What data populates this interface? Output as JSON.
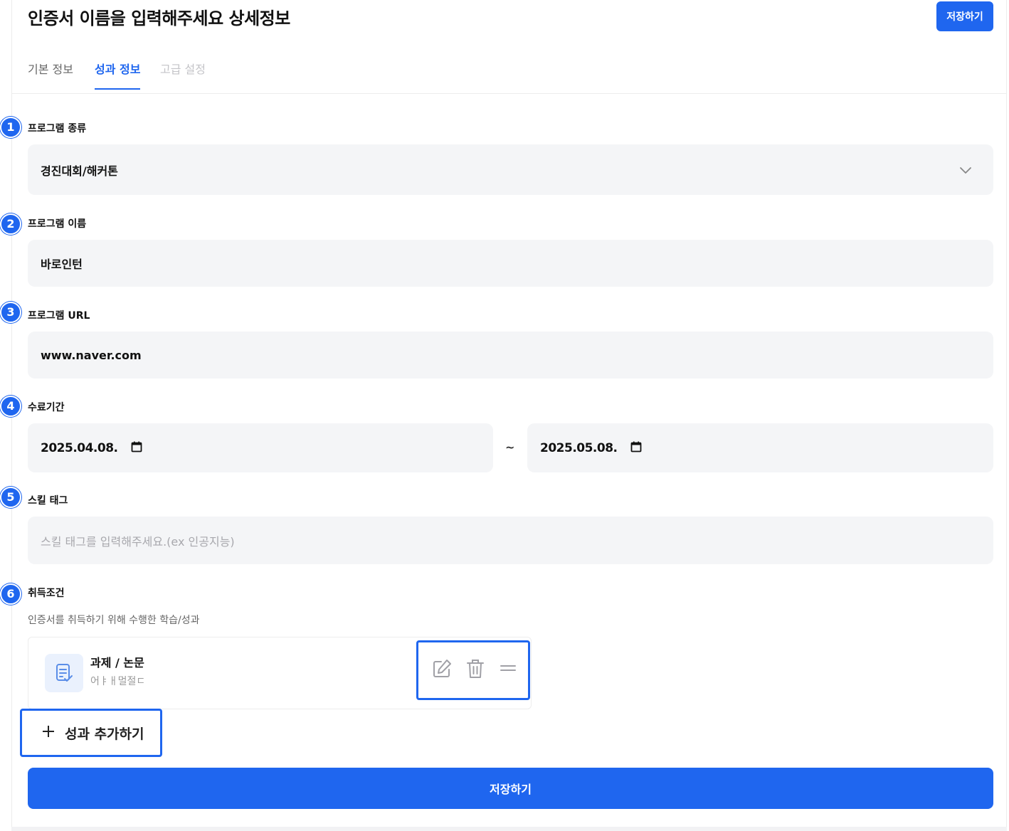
{
  "header": {
    "title": "인증서 이름을 입력해주세요 상세정보",
    "save_label": "저장하기"
  },
  "tabs": [
    {
      "label": "기본 정보",
      "state": "default"
    },
    {
      "label": "성과 정보",
      "state": "active"
    },
    {
      "label": "고급 설정",
      "state": "disabled"
    }
  ],
  "form": {
    "program_type": {
      "marker": "1",
      "label": "프로그램 종류",
      "value": "경진대회/해커톤"
    },
    "program_name": {
      "marker": "2",
      "label": "프로그램 이름",
      "value": "바로인턴"
    },
    "program_url": {
      "marker": "3",
      "label": "프로그램 URL",
      "value": "www.naver.com"
    },
    "period": {
      "marker": "4",
      "label": "수료기간",
      "start": "2025.04.08.",
      "separator": "~",
      "end": "2025.05.08."
    },
    "skill_tags": {
      "marker": "5",
      "label": "스킬 태그",
      "placeholder": "스킬 태그를 입력해주세요.(ex 인공지능)"
    },
    "conditions": {
      "marker": "6",
      "label": "취득조건",
      "description": "인증서를 취득하기 위해 수행한 학습/성과",
      "items": [
        {
          "title": "과제 / 논문",
          "subtitle": "어ㅑㅐ멀절ㄷ"
        }
      ],
      "add_label": "성과 추가하기"
    }
  },
  "footer": {
    "save_label": "저장하기"
  },
  "colors": {
    "accent": "#1f66ef",
    "field_bg": "#f4f5f7",
    "icon_bg": "#eaf1fd"
  },
  "icons": {
    "select": "chevron-down-icon",
    "date": "calendar-icon",
    "item": "document-check-icon",
    "edit": "edit-icon",
    "delete": "trash-icon",
    "drag": "drag-handle-icon",
    "add": "plus-icon"
  }
}
